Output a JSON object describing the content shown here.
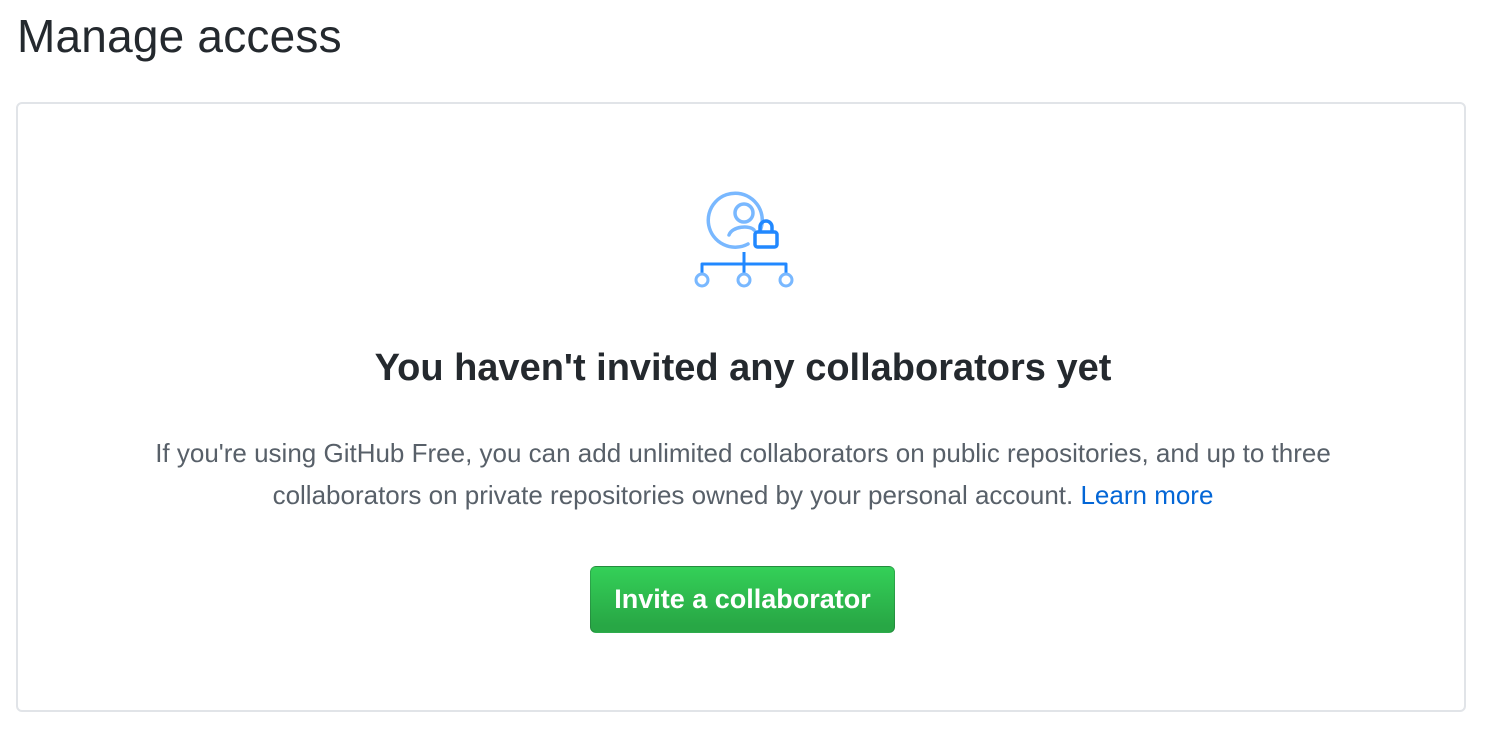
{
  "page": {
    "title": "Manage access"
  },
  "empty_state": {
    "icon": "collaborators-lock-icon",
    "heading": "You haven't invited any collaborators yet",
    "description": "If you're using GitHub Free, you can add unlimited collaborators on public repositories, and up to three collaborators on private repositories owned by your personal account.",
    "learn_more_label": "Learn more",
    "invite_button_label": "Invite a collaborator"
  },
  "colors": {
    "primary_button": "#2ea44f",
    "link": "#0366d6",
    "icon_light": "#79b8ff",
    "icon_dark": "#2188ff",
    "border": "#e1e4e8",
    "heading_text": "#24292e",
    "muted_text": "#586069"
  }
}
